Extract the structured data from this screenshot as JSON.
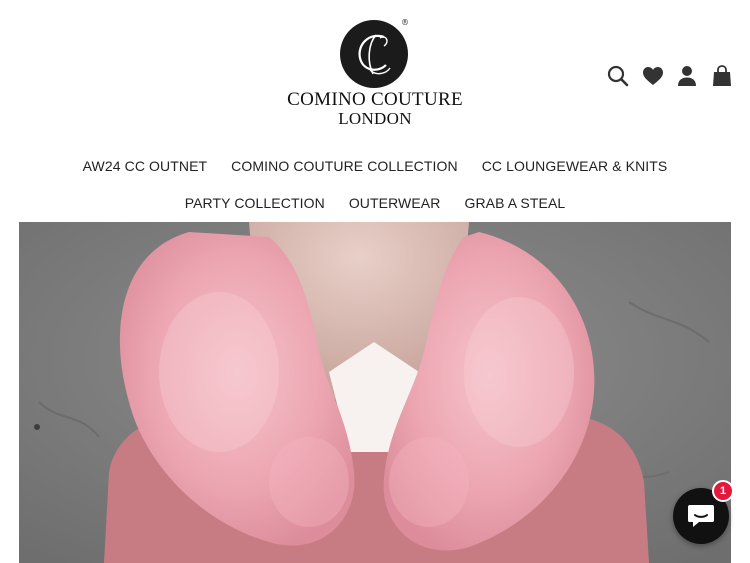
{
  "brand": {
    "line1": "COMINO COUTURE",
    "line2": "LONDON",
    "monogram": "C",
    "registered": "®"
  },
  "header_icons": [
    "search-icon",
    "wishlist-heart-icon",
    "account-icon",
    "cart-bag-icon"
  ],
  "nav": {
    "row1": [
      "AW24 CC OUTNET",
      "COMINO COUTURE COLLECTION",
      "CC LOUNGEWEAR & KNITS"
    ],
    "row2": [
      "PARTY COLLECTION",
      "OUTERWEAR",
      "GRAB A STEAL"
    ]
  },
  "chat": {
    "badge_count": "1"
  },
  "colors": {
    "accent_pink": "#e79aa7",
    "badge_red": "#e3183d",
    "logo_black": "#1b1b1b"
  }
}
